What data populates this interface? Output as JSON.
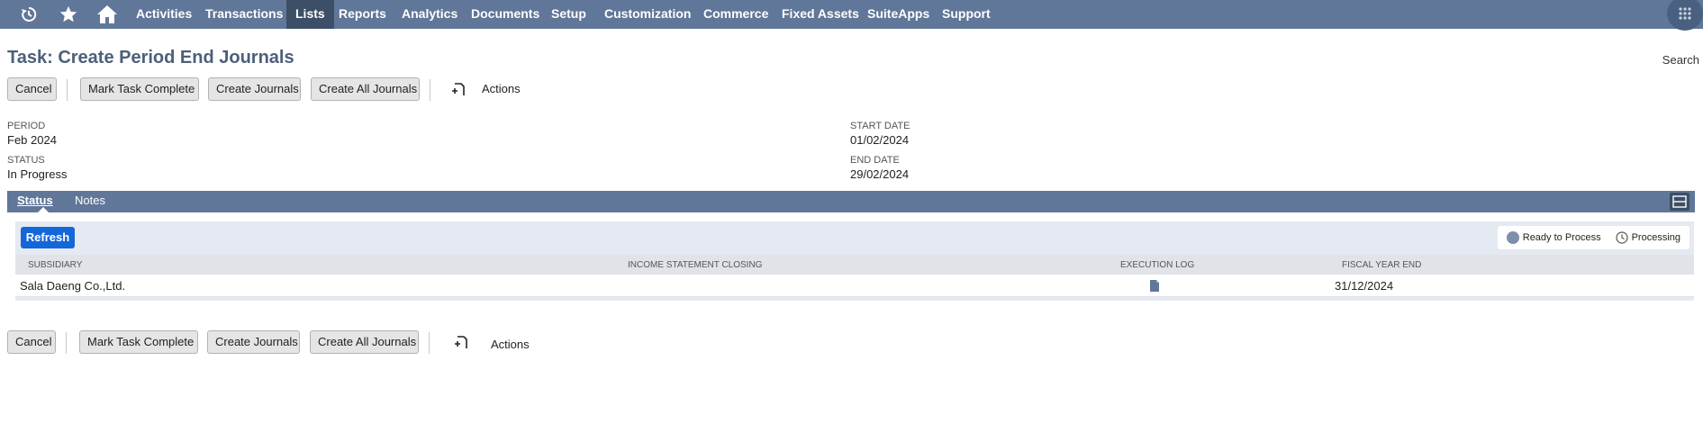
{
  "nav": {
    "icons": [
      "recent-icon",
      "star-icon",
      "home-icon"
    ],
    "items": [
      {
        "label": "Activities"
      },
      {
        "label": "Transactions"
      },
      {
        "label": "Lists",
        "active": true
      },
      {
        "label": "Reports"
      },
      {
        "label": "Analytics"
      },
      {
        "label": "Documents"
      },
      {
        "label": "Setup"
      },
      {
        "label": "Customization"
      },
      {
        "label": "Commerce"
      },
      {
        "label": "Fixed Assets"
      },
      {
        "label": "SuiteApps"
      },
      {
        "label": "Support"
      }
    ]
  },
  "page": {
    "title": "Task: Create Period End Journals",
    "search": "Search"
  },
  "buttons": {
    "cancel": "Cancel",
    "mark_complete": "Mark Task Complete",
    "create_journals": "Create Journals",
    "create_all": "Create All Journals",
    "actions": "Actions"
  },
  "fields": {
    "period_label": "PERIOD",
    "period_value": "Feb 2024",
    "status_label": "STATUS",
    "status_value": "In Progress",
    "start_label": "START DATE",
    "start_value": "01/02/2024",
    "end_label": "END DATE",
    "end_value": "29/02/2024"
  },
  "tabs": {
    "status": "Status",
    "notes": "Notes"
  },
  "subpanel": {
    "refresh": "Refresh",
    "legend_ready": "Ready to Process",
    "legend_processing": "Processing"
  },
  "table": {
    "columns": [
      "SUBSIDIARY",
      "INCOME STATEMENT CLOSING",
      "EXECUTION LOG",
      "FISCAL YEAR END"
    ],
    "rows": [
      {
        "subsidiary": "Sala Daeng Co.,Ltd.",
        "income_statement_closing": "",
        "execution_log_icon": "document-icon",
        "fiscal_year_end": "31/12/2024"
      }
    ]
  },
  "colors": {
    "nav_bg": "#607799",
    "nav_active": "#3c4f66",
    "title": "#4d5f79",
    "refresh": "#1467d9",
    "ready_dot": "#7e8fab"
  }
}
